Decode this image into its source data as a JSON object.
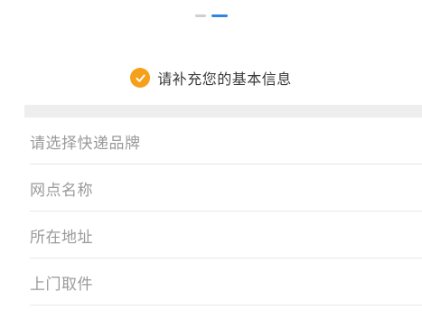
{
  "steps": {
    "total": 2,
    "current": 2
  },
  "notice": {
    "icon": "check-circle-icon",
    "icon_color": "#f5a018",
    "text": "请补充您的基本信息"
  },
  "form": {
    "fields": [
      {
        "placeholder": "请选择快递品牌"
      },
      {
        "placeholder": "网点名称"
      },
      {
        "placeholder": "所在地址"
      },
      {
        "placeholder": "上门取件"
      }
    ]
  },
  "colors": {
    "accent": "#2f86e0",
    "placeholder_text": "#9a9a9a"
  }
}
